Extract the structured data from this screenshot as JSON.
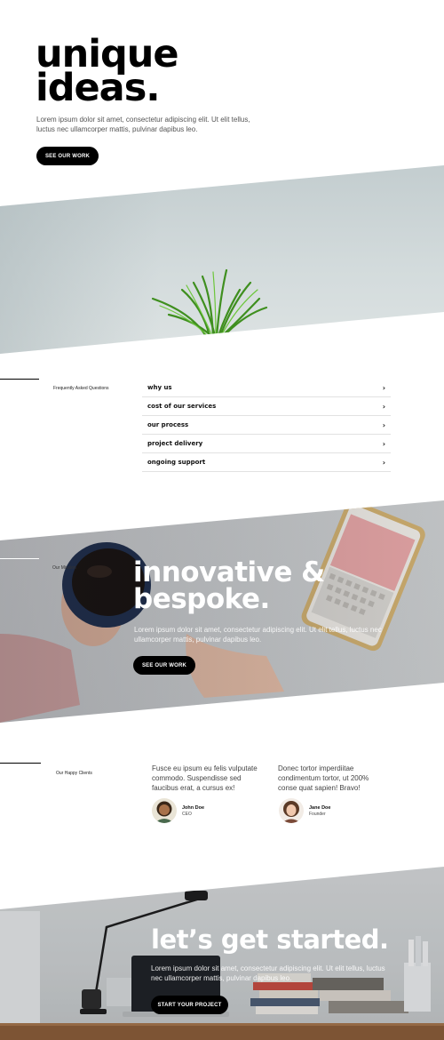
{
  "hero": {
    "title_line1": "unique",
    "title_line2": "ideas.",
    "text": "Lorem ipsum dolor sit amet, consectetur adipiscing elit. Ut elit tellus, luctus nec ullamcorper mattis, pulvinar dapibus leo.",
    "button_label": "SEE OUR WORK"
  },
  "faq": {
    "label": "Frequently Asked Questions",
    "items": [
      {
        "question": "why us",
        "icon": "chevron-right-icon"
      },
      {
        "question": "cost of our services",
        "icon": "chevron-right-icon"
      },
      {
        "question": "our process",
        "icon": "chevron-right-icon"
      },
      {
        "question": "project delivery",
        "icon": "chevron-right-icon"
      },
      {
        "question": "ongoing support",
        "icon": "chevron-right-icon"
      }
    ]
  },
  "mission": {
    "label": "Our Mission",
    "title_line1": "innovative &",
    "title_line2": "bespoke.",
    "text": "Lorem ipsum dolor sit amet, consectetur adipiscing elit. Ut elit tellus, luctus nec ullamcorper mattis, pulvinar dapibus leo.",
    "button_label": "SEE OUR WORK"
  },
  "clients": {
    "label": "Our Happy Clients",
    "testimonials": [
      {
        "quote": "Fusce eu ipsum eu felis vulputate commodo. Suspendisse sed faucibus erat, a cursus ex!",
        "name": "John Doe",
        "role": "CEO"
      },
      {
        "quote": "Donec tortor imperdiitae condimentum tortor, ut 200% conse quat sapien! Bravo!",
        "name": "Jane Doe",
        "role": "Founder"
      }
    ]
  },
  "cta": {
    "title": "let’s get started.",
    "text": "Lorem ipsum dolor sit amet, consectetur adipiscing elit. Ut elit tellus, luctus nec ullamcorper mattis, pulvinar dapibus leo.",
    "button_label": "START YOUR PROJECT"
  },
  "colors": {
    "primary": "#000000",
    "background": "#ffffff",
    "on_image_text": "#ffffff"
  }
}
